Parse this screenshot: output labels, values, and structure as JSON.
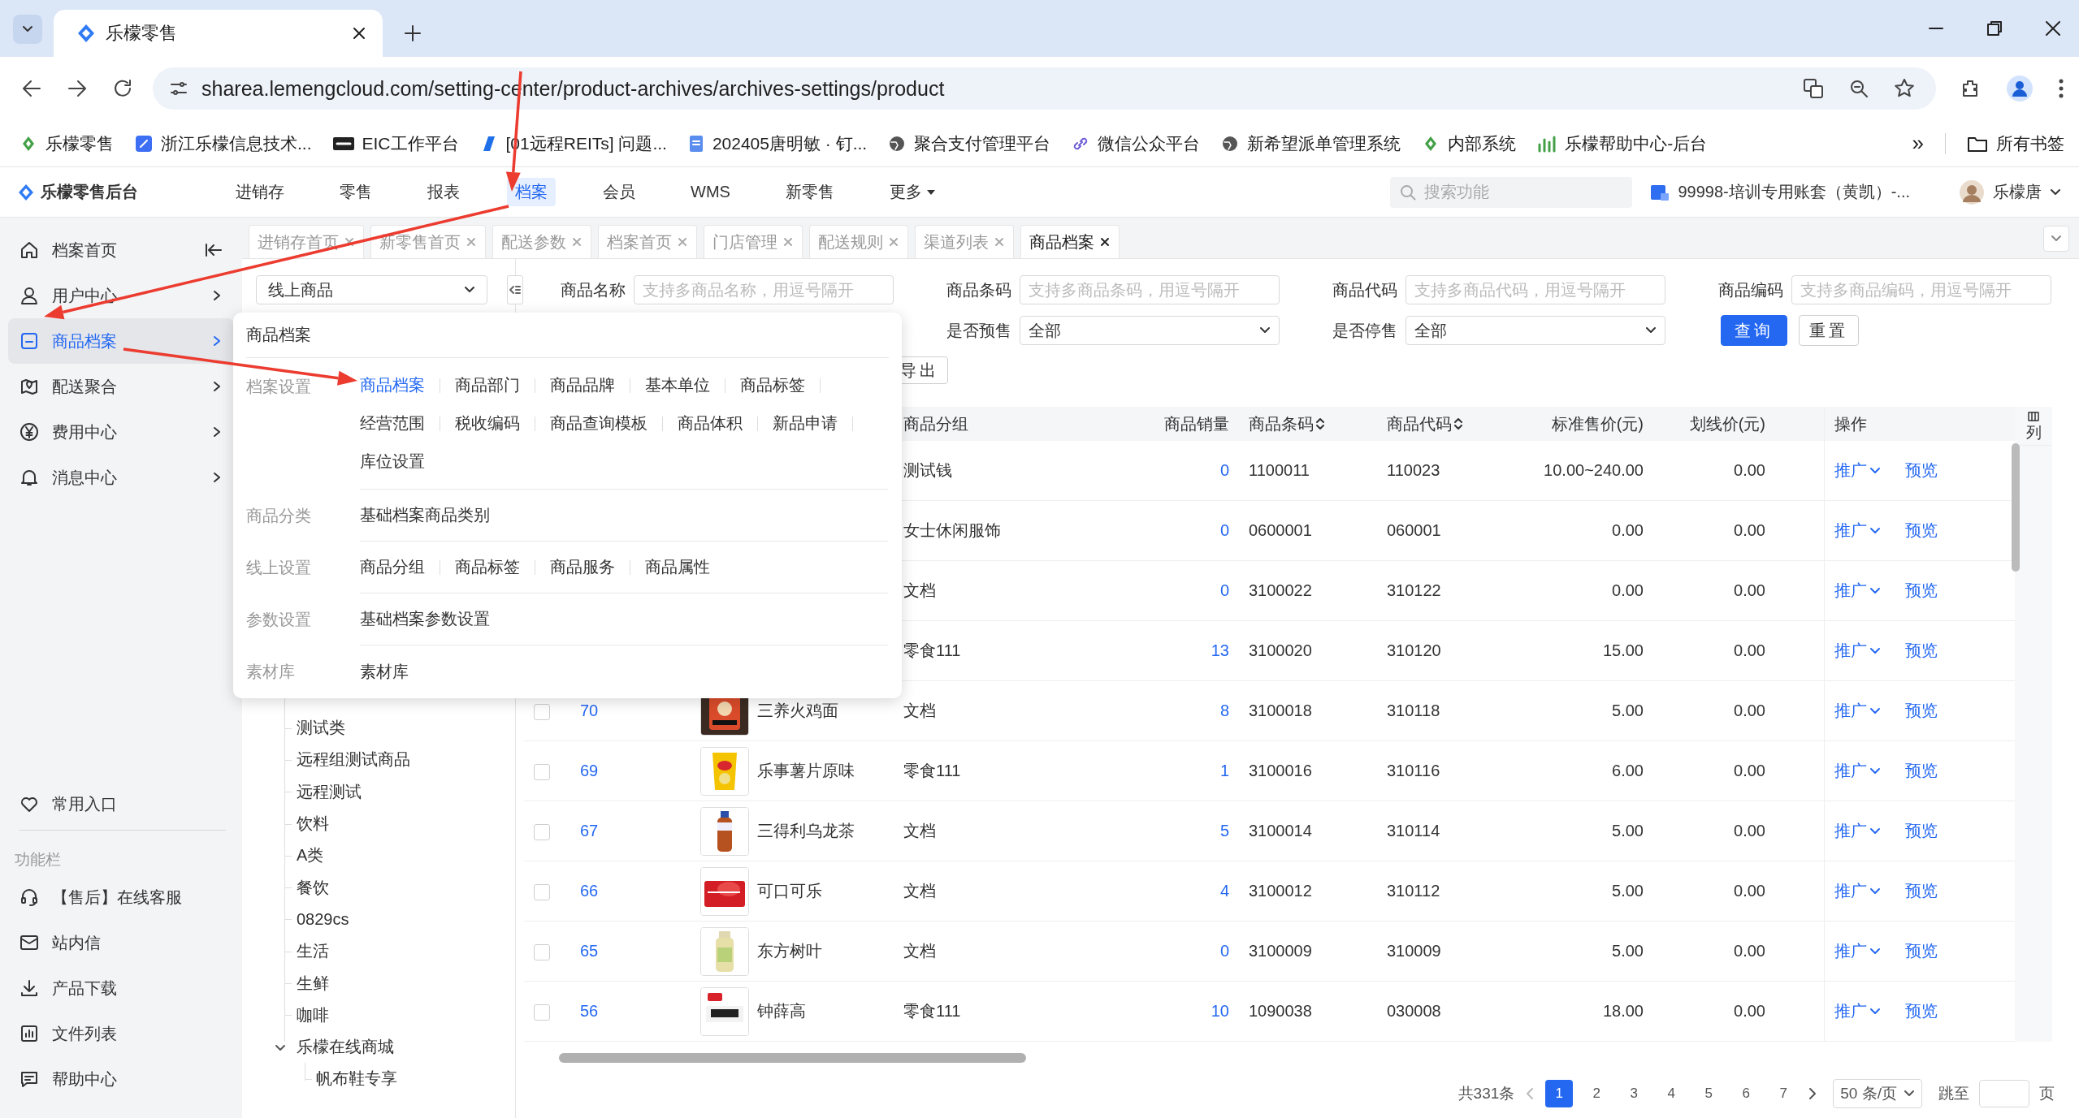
{
  "browser": {
    "tab_title": "乐檬零售",
    "url": "sharea.lemengcloud.com/setting-center/product-archives/archives-settings/product",
    "bookmarks": [
      {
        "label": "乐檬零售",
        "kind": "leaf"
      },
      {
        "label": "浙江乐檬信息技术...",
        "kind": "app"
      },
      {
        "label": "EIC工作平台",
        "kind": "eic"
      },
      {
        "label": "[01远程REITs] 问题...",
        "kind": "flag"
      },
      {
        "label": "202405唐明敏 · 钉...",
        "kind": "doc"
      },
      {
        "label": "聚合支付管理平台",
        "kind": "globe"
      },
      {
        "label": "微信公众平台",
        "kind": "link"
      },
      {
        "label": "新希望派单管理系统",
        "kind": "globe"
      },
      {
        "label": "内部系统",
        "kind": "leaf"
      },
      {
        "label": "乐檬帮助中心-后台",
        "kind": "chart"
      }
    ],
    "bookmarks_overflow": "»",
    "all_bookmarks": "所有书签"
  },
  "app": {
    "brand": "乐檬零售后台",
    "nav": [
      {
        "label": "进销存",
        "selected": false
      },
      {
        "label": "零售",
        "selected": false
      },
      {
        "label": "报表",
        "selected": false
      },
      {
        "label": "档案",
        "selected": true
      },
      {
        "label": "会员",
        "selected": false
      },
      {
        "label": "WMS",
        "selected": false
      },
      {
        "label": "新零售",
        "selected": false
      },
      {
        "label": "更多",
        "selected": false
      }
    ],
    "search": {
      "placeholder": "搜索功能"
    },
    "account": "99998-培训专用账套（黄凯）-...",
    "user": "乐檬唐"
  },
  "sidebar": {
    "items": [
      {
        "label": "档案首页",
        "selected": false
      },
      {
        "label": "用户中心",
        "selected": false
      },
      {
        "label": "商品档案",
        "selected": true
      },
      {
        "label": "配送聚合",
        "selected": false
      },
      {
        "label": "费用中心",
        "selected": false
      },
      {
        "label": "消息中心",
        "selected": false
      }
    ],
    "favorites": "常用入口",
    "section": "功能栏",
    "tools": [
      {
        "label": "【售后】在线客服"
      },
      {
        "label": "站内信"
      },
      {
        "label": "产品下载"
      },
      {
        "label": "文件列表"
      },
      {
        "label": "帮助中心"
      }
    ]
  },
  "page_tabs": [
    {
      "label": "进销存首页",
      "selected": false
    },
    {
      "label": "新零售首页",
      "selected": false
    },
    {
      "label": "配送参数",
      "selected": false
    },
    {
      "label": "档案首页",
      "selected": false
    },
    {
      "label": "门店管理",
      "selected": false
    },
    {
      "label": "配送规则",
      "selected": false
    },
    {
      "label": "渠道列表",
      "selected": false
    },
    {
      "label": "商品档案",
      "selected": true
    }
  ],
  "filters": {
    "scope": "线上商品",
    "fields": [
      {
        "label": "商品名称",
        "placeholder": "支持多商品名称，用逗号隔开"
      },
      {
        "label": "商品条码",
        "placeholder": "支持多商品条码，用逗号隔开"
      },
      {
        "label": "商品代码",
        "placeholder": "支持多商品代码，用逗号隔开"
      },
      {
        "label": "商品编码",
        "placeholder": "支持多商品编码，用逗号隔开"
      }
    ],
    "selects": [
      {
        "label": "是否预售",
        "value": "全部"
      },
      {
        "label": "是否停售",
        "value": "全部"
      }
    ],
    "search_button": "查询",
    "reset_button": "重置",
    "export_button": "导出"
  },
  "tree": {
    "items": [
      {
        "label": "测试类"
      },
      {
        "label": "远程组测试商品"
      },
      {
        "label": "远程测试"
      },
      {
        "label": "饮料"
      },
      {
        "label": "A类"
      },
      {
        "label": "餐饮"
      },
      {
        "label": "0829cs"
      },
      {
        "label": "生活"
      },
      {
        "label": "生鲜"
      },
      {
        "label": "咖啡"
      },
      {
        "label": "乐檬在线商城",
        "expanded": true,
        "children": [
          {
            "label": "帆布鞋专享"
          }
        ]
      }
    ]
  },
  "table": {
    "columns": [
      {
        "label": "商品分组",
        "sortable": false
      },
      {
        "label": "商品销量",
        "sortable": false
      },
      {
        "label": "商品条码",
        "sortable": true
      },
      {
        "label": "商品代码",
        "sortable": true
      },
      {
        "label": "标准售价(元)",
        "sortable": false
      },
      {
        "label": "划线价(元)",
        "sortable": false
      },
      {
        "label": "操作",
        "sortable": false
      }
    ],
    "column_settings": "列",
    "rows": [
      {
        "group": "测试钱",
        "sales": "0",
        "barcode": "1100011",
        "code": "110023",
        "price": "10.00~240.00",
        "strike_price": "0.00",
        "actions": [
          "推广",
          "预览"
        ]
      },
      {
        "group": "女士休闲服饰",
        "sales": "0",
        "barcode": "0600001",
        "code": "060001",
        "price": "0.00",
        "strike_price": "0.00",
        "actions": [
          "推广",
          "预览"
        ]
      },
      {
        "group": "文档",
        "sales": "0",
        "barcode": "3100022",
        "code": "310122",
        "price": "0.00",
        "strike_price": "0.00",
        "actions": [
          "推广",
          "预览"
        ]
      },
      {
        "group": "零食111",
        "sales": "13",
        "barcode": "3100020",
        "code": "310120",
        "price": "15.00",
        "strike_price": "0.00",
        "actions": [
          "推广",
          "预览"
        ]
      },
      {
        "checked": false,
        "id": "70",
        "name": "三养火鸡面",
        "group": "文档",
        "sales": "8",
        "barcode": "3100018",
        "code": "310118",
        "price": "5.00",
        "strike_price": "0.00",
        "actions": [
          "推广",
          "预览"
        ]
      },
      {
        "checked": false,
        "id": "69",
        "name": "乐事薯片原味",
        "group": "零食111",
        "sales": "1",
        "barcode": "3100016",
        "code": "310116",
        "price": "6.00",
        "strike_price": "0.00",
        "actions": [
          "推广",
          "预览"
        ]
      },
      {
        "checked": false,
        "id": "67",
        "name": "三得利乌龙茶",
        "group": "文档",
        "sales": "5",
        "barcode": "3100014",
        "code": "310114",
        "price": "5.00",
        "strike_price": "0.00",
        "actions": [
          "推广",
          "预览"
        ]
      },
      {
        "checked": false,
        "id": "66",
        "name": "可口可乐",
        "group": "文档",
        "sales": "4",
        "barcode": "3100012",
        "code": "310112",
        "price": "5.00",
        "strike_price": "0.00",
        "actions": [
          "推广",
          "预览"
        ]
      },
      {
        "checked": false,
        "id": "65",
        "name": "东方树叶",
        "group": "文档",
        "sales": "0",
        "barcode": "3100009",
        "code": "310009",
        "price": "5.00",
        "strike_price": "0.00",
        "actions": [
          "推广",
          "预览"
        ]
      },
      {
        "checked": false,
        "id": "56",
        "name": "钟薛高",
        "group": "零食111",
        "sales": "10",
        "barcode": "1090038",
        "code": "030008",
        "price": "18.00",
        "strike_price": "0.00",
        "actions": [
          "推广",
          "预览"
        ]
      }
    ]
  },
  "pagination": {
    "total": "共331条",
    "pages": [
      {
        "label": "1",
        "selected": true
      },
      {
        "label": "2",
        "selected": false
      },
      {
        "label": "3",
        "selected": false
      },
      {
        "label": "4",
        "selected": false
      },
      {
        "label": "5",
        "selected": false
      },
      {
        "label": "6",
        "selected": false
      },
      {
        "label": "7",
        "selected": false
      }
    ],
    "page_size": "50 条/页",
    "jump_label": "跳至",
    "page_unit": "页"
  },
  "mega_menu": {
    "title": "商品档案",
    "groups": [
      {
        "label": "档案设置",
        "links": [
          {
            "label": "商品档案",
            "selected": true
          },
          {
            "label": "商品部门",
            "selected": false
          },
          {
            "label": "商品品牌",
            "selected": false
          },
          {
            "label": "基本单位",
            "selected": false
          },
          {
            "label": "商品标签",
            "selected": false
          },
          {
            "label": "经营范围",
            "selected": false
          },
          {
            "label": "税收编码",
            "selected": false
          },
          {
            "label": "商品查询模板",
            "selected": false
          },
          {
            "label": "商品体积",
            "selected": false
          },
          {
            "label": "新品申请",
            "selected": false
          },
          {
            "label": "库位设置",
            "selected": false
          }
        ]
      },
      {
        "label": "商品分类",
        "links": [
          {
            "label": "基础档案商品类别",
            "selected": false
          }
        ]
      },
      {
        "label": "线上设置",
        "links": [
          {
            "label": "商品分组",
            "selected": false
          },
          {
            "label": "商品标签",
            "selected": false
          },
          {
            "label": "商品服务",
            "selected": false
          },
          {
            "label": "商品属性",
            "selected": false
          }
        ]
      },
      {
        "label": "参数设置",
        "links": [
          {
            "label": "基础档案参数设置",
            "selected": false
          }
        ]
      },
      {
        "label": "素材库",
        "links": [
          {
            "label": "素材库",
            "selected": false
          }
        ]
      }
    ]
  },
  "annotations": [
    {
      "kind": "arrow"
    },
    {
      "kind": "arrow"
    },
    {
      "kind": "arrow"
    }
  ]
}
